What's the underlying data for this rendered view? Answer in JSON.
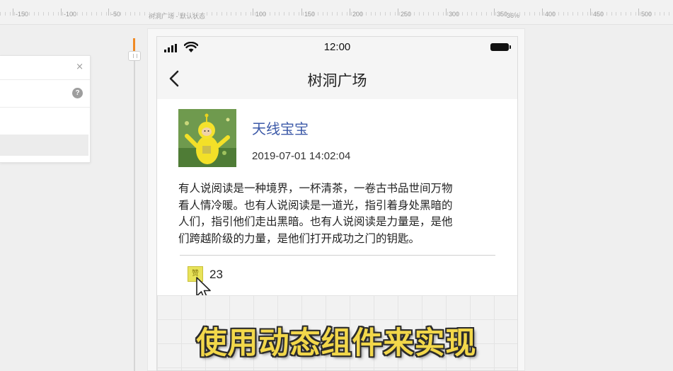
{
  "ruler": {
    "labels": [
      "-150",
      "-100",
      "-50",
      "100",
      "150",
      "200",
      "250",
      "300",
      "350",
      "400",
      "450",
      "500"
    ],
    "caption": "树洞广场 - 默认状态",
    "zoom": "36%"
  },
  "left_panel": {
    "close_glyph": "×",
    "help_glyph": "?"
  },
  "phone": {
    "status_time": "12:00",
    "nav_title": "树洞广场",
    "post": {
      "username": "天线宝宝",
      "time": "2019-07-01 14:02:04",
      "body": "有人说阅读是一种境界，一杯清茶，一卷古书品世间万物\n看人情冷暖。也有人说阅读是一道光，指引着身处黑暗的\n人们，指引他们走出黑暗。也有人说阅读是力量是，是他\n们跨越阶级的力量，是他们打开成功之门的钥匙。",
      "like_count": "23",
      "like_icon_glyph": "赞"
    }
  },
  "subtitle": "使用动态组件来实现",
  "colors": {
    "accent_slider": "#f08a24",
    "username": "#3d5aa8",
    "subtitle_fill": "#f2d74a"
  },
  "icons": [
    "close-icon",
    "help-icon",
    "signal-icon",
    "wifi-icon",
    "battery-icon",
    "back-chevron-icon",
    "like-icon",
    "mouse-cursor-icon"
  ]
}
